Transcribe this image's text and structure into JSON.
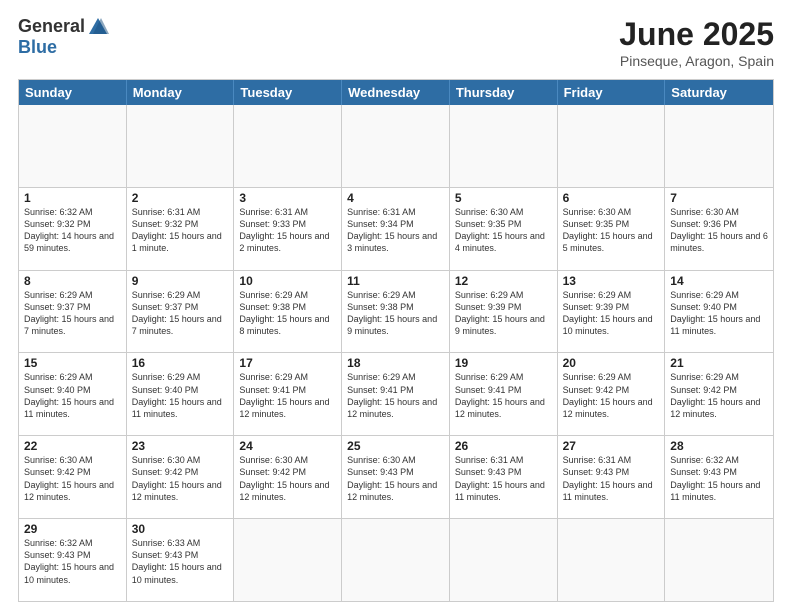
{
  "logo": {
    "general": "General",
    "blue": "Blue"
  },
  "title": "June 2025",
  "subtitle": "Pinseque, Aragon, Spain",
  "header_days": [
    "Sunday",
    "Monday",
    "Tuesday",
    "Wednesday",
    "Thursday",
    "Friday",
    "Saturday"
  ],
  "rows": [
    [
      {
        "day": "",
        "sunrise": "",
        "sunset": "",
        "daylight": "",
        "empty": true
      },
      {
        "day": "",
        "sunrise": "",
        "sunset": "",
        "daylight": "",
        "empty": true
      },
      {
        "day": "",
        "sunrise": "",
        "sunset": "",
        "daylight": "",
        "empty": true
      },
      {
        "day": "",
        "sunrise": "",
        "sunset": "",
        "daylight": "",
        "empty": true
      },
      {
        "day": "",
        "sunrise": "",
        "sunset": "",
        "daylight": "",
        "empty": true
      },
      {
        "day": "",
        "sunrise": "",
        "sunset": "",
        "daylight": "",
        "empty": true
      },
      {
        "day": "",
        "sunrise": "",
        "sunset": "",
        "daylight": "",
        "empty": true
      }
    ],
    [
      {
        "day": "1",
        "sunrise": "Sunrise: 6:32 AM",
        "sunset": "Sunset: 9:32 PM",
        "daylight": "Daylight: 14 hours and 59 minutes.",
        "empty": false
      },
      {
        "day": "2",
        "sunrise": "Sunrise: 6:31 AM",
        "sunset": "Sunset: 9:32 PM",
        "daylight": "Daylight: 15 hours and 1 minute.",
        "empty": false
      },
      {
        "day": "3",
        "sunrise": "Sunrise: 6:31 AM",
        "sunset": "Sunset: 9:33 PM",
        "daylight": "Daylight: 15 hours and 2 minutes.",
        "empty": false
      },
      {
        "day": "4",
        "sunrise": "Sunrise: 6:31 AM",
        "sunset": "Sunset: 9:34 PM",
        "daylight": "Daylight: 15 hours and 3 minutes.",
        "empty": false
      },
      {
        "day": "5",
        "sunrise": "Sunrise: 6:30 AM",
        "sunset": "Sunset: 9:35 PM",
        "daylight": "Daylight: 15 hours and 4 minutes.",
        "empty": false
      },
      {
        "day": "6",
        "sunrise": "Sunrise: 6:30 AM",
        "sunset": "Sunset: 9:35 PM",
        "daylight": "Daylight: 15 hours and 5 minutes.",
        "empty": false
      },
      {
        "day": "7",
        "sunrise": "Sunrise: 6:30 AM",
        "sunset": "Sunset: 9:36 PM",
        "daylight": "Daylight: 15 hours and 6 minutes.",
        "empty": false
      }
    ],
    [
      {
        "day": "8",
        "sunrise": "Sunrise: 6:29 AM",
        "sunset": "Sunset: 9:37 PM",
        "daylight": "Daylight: 15 hours and 7 minutes.",
        "empty": false
      },
      {
        "day": "9",
        "sunrise": "Sunrise: 6:29 AM",
        "sunset": "Sunset: 9:37 PM",
        "daylight": "Daylight: 15 hours and 7 minutes.",
        "empty": false
      },
      {
        "day": "10",
        "sunrise": "Sunrise: 6:29 AM",
        "sunset": "Sunset: 9:38 PM",
        "daylight": "Daylight: 15 hours and 8 minutes.",
        "empty": false
      },
      {
        "day": "11",
        "sunrise": "Sunrise: 6:29 AM",
        "sunset": "Sunset: 9:38 PM",
        "daylight": "Daylight: 15 hours and 9 minutes.",
        "empty": false
      },
      {
        "day": "12",
        "sunrise": "Sunrise: 6:29 AM",
        "sunset": "Sunset: 9:39 PM",
        "daylight": "Daylight: 15 hours and 9 minutes.",
        "empty": false
      },
      {
        "day": "13",
        "sunrise": "Sunrise: 6:29 AM",
        "sunset": "Sunset: 9:39 PM",
        "daylight": "Daylight: 15 hours and 10 minutes.",
        "empty": false
      },
      {
        "day": "14",
        "sunrise": "Sunrise: 6:29 AM",
        "sunset": "Sunset: 9:40 PM",
        "daylight": "Daylight: 15 hours and 11 minutes.",
        "empty": false
      }
    ],
    [
      {
        "day": "15",
        "sunrise": "Sunrise: 6:29 AM",
        "sunset": "Sunset: 9:40 PM",
        "daylight": "Daylight: 15 hours and 11 minutes.",
        "empty": false
      },
      {
        "day": "16",
        "sunrise": "Sunrise: 6:29 AM",
        "sunset": "Sunset: 9:40 PM",
        "daylight": "Daylight: 15 hours and 11 minutes.",
        "empty": false
      },
      {
        "day": "17",
        "sunrise": "Sunrise: 6:29 AM",
        "sunset": "Sunset: 9:41 PM",
        "daylight": "Daylight: 15 hours and 12 minutes.",
        "empty": false
      },
      {
        "day": "18",
        "sunrise": "Sunrise: 6:29 AM",
        "sunset": "Sunset: 9:41 PM",
        "daylight": "Daylight: 15 hours and 12 minutes.",
        "empty": false
      },
      {
        "day": "19",
        "sunrise": "Sunrise: 6:29 AM",
        "sunset": "Sunset: 9:41 PM",
        "daylight": "Daylight: 15 hours and 12 minutes.",
        "empty": false
      },
      {
        "day": "20",
        "sunrise": "Sunrise: 6:29 AM",
        "sunset": "Sunset: 9:42 PM",
        "daylight": "Daylight: 15 hours and 12 minutes.",
        "empty": false
      },
      {
        "day": "21",
        "sunrise": "Sunrise: 6:29 AM",
        "sunset": "Sunset: 9:42 PM",
        "daylight": "Daylight: 15 hours and 12 minutes.",
        "empty": false
      }
    ],
    [
      {
        "day": "22",
        "sunrise": "Sunrise: 6:30 AM",
        "sunset": "Sunset: 9:42 PM",
        "daylight": "Daylight: 15 hours and 12 minutes.",
        "empty": false
      },
      {
        "day": "23",
        "sunrise": "Sunrise: 6:30 AM",
        "sunset": "Sunset: 9:42 PM",
        "daylight": "Daylight: 15 hours and 12 minutes.",
        "empty": false
      },
      {
        "day": "24",
        "sunrise": "Sunrise: 6:30 AM",
        "sunset": "Sunset: 9:42 PM",
        "daylight": "Daylight: 15 hours and 12 minutes.",
        "empty": false
      },
      {
        "day": "25",
        "sunrise": "Sunrise: 6:30 AM",
        "sunset": "Sunset: 9:43 PM",
        "daylight": "Daylight: 15 hours and 12 minutes.",
        "empty": false
      },
      {
        "day": "26",
        "sunrise": "Sunrise: 6:31 AM",
        "sunset": "Sunset: 9:43 PM",
        "daylight": "Daylight: 15 hours and 11 minutes.",
        "empty": false
      },
      {
        "day": "27",
        "sunrise": "Sunrise: 6:31 AM",
        "sunset": "Sunset: 9:43 PM",
        "daylight": "Daylight: 15 hours and 11 minutes.",
        "empty": false
      },
      {
        "day": "28",
        "sunrise": "Sunrise: 6:32 AM",
        "sunset": "Sunset: 9:43 PM",
        "daylight": "Daylight: 15 hours and 11 minutes.",
        "empty": false
      }
    ],
    [
      {
        "day": "29",
        "sunrise": "Sunrise: 6:32 AM",
        "sunset": "Sunset: 9:43 PM",
        "daylight": "Daylight: 15 hours and 10 minutes.",
        "empty": false
      },
      {
        "day": "30",
        "sunrise": "Sunrise: 6:33 AM",
        "sunset": "Sunset: 9:43 PM",
        "daylight": "Daylight: 15 hours and 10 minutes.",
        "empty": false
      },
      {
        "day": "",
        "sunrise": "",
        "sunset": "",
        "daylight": "",
        "empty": true
      },
      {
        "day": "",
        "sunrise": "",
        "sunset": "",
        "daylight": "",
        "empty": true
      },
      {
        "day": "",
        "sunrise": "",
        "sunset": "",
        "daylight": "",
        "empty": true
      },
      {
        "day": "",
        "sunrise": "",
        "sunset": "",
        "daylight": "",
        "empty": true
      },
      {
        "day": "",
        "sunrise": "",
        "sunset": "",
        "daylight": "",
        "empty": true
      }
    ]
  ]
}
